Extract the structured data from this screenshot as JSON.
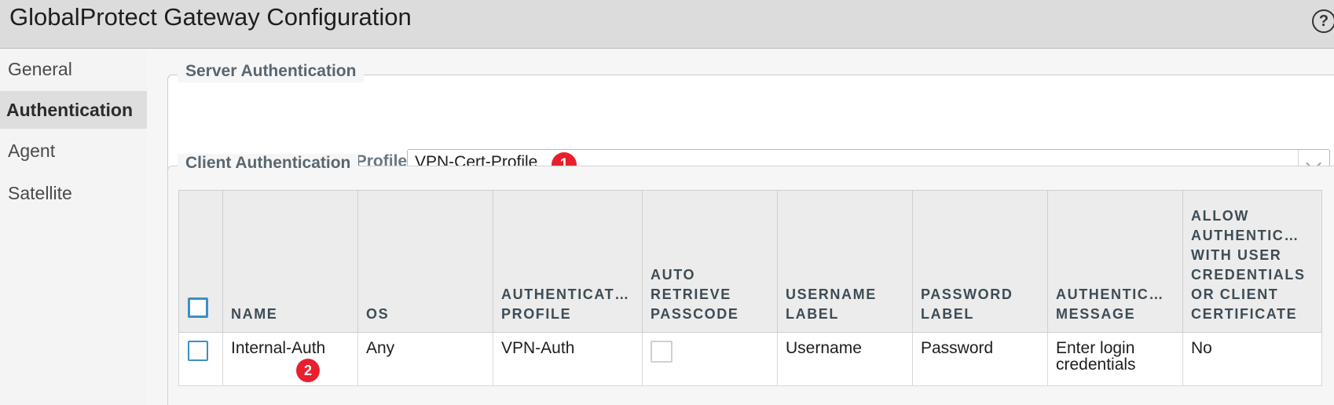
{
  "window": {
    "title": "GlobalProtect Gateway Configuration",
    "help_glyph": "?"
  },
  "sidebar": {
    "items": [
      {
        "label": "General",
        "active": false
      },
      {
        "label": "Authentication",
        "active": true
      },
      {
        "label": "Agent",
        "active": false
      },
      {
        "label": "Satellite",
        "active": false
      }
    ]
  },
  "server_auth": {
    "legend": "Server Authentication",
    "ssl_label": "SSL/TLS Service Profile",
    "ssl_value": "VPN-Cert-Profile",
    "badge": "1"
  },
  "client_auth": {
    "legend": "Client Authentication",
    "columns": {
      "name": "NAME",
      "os": "OS",
      "auth_profile": "AUTHENTICAT… PROFILE",
      "auto_retrieve": "AUTO RETRIEVE PASSCODE",
      "username_label": "USERNAME LABEL",
      "password_label": "PASSWORD LABEL",
      "auth_message": "AUTHENTIC… MESSAGE",
      "allow_auth": "ALLOW AUTHENTIC… WITH USER CREDENTIALS OR CLIENT CERTIFICATE"
    },
    "rows": [
      {
        "name": "Internal-Auth",
        "os": "Any",
        "auth_profile": "VPN-Auth",
        "auto_retrieve": false,
        "username_label": "Username",
        "password_label": "Password",
        "auth_message": "Enter login credentials",
        "allow_auth": "No",
        "badge": "2"
      }
    ]
  },
  "colors": {
    "checkbox_border": "#3a8fc9",
    "badge": "#e8202e",
    "titlebar": "#dcdcdc"
  }
}
